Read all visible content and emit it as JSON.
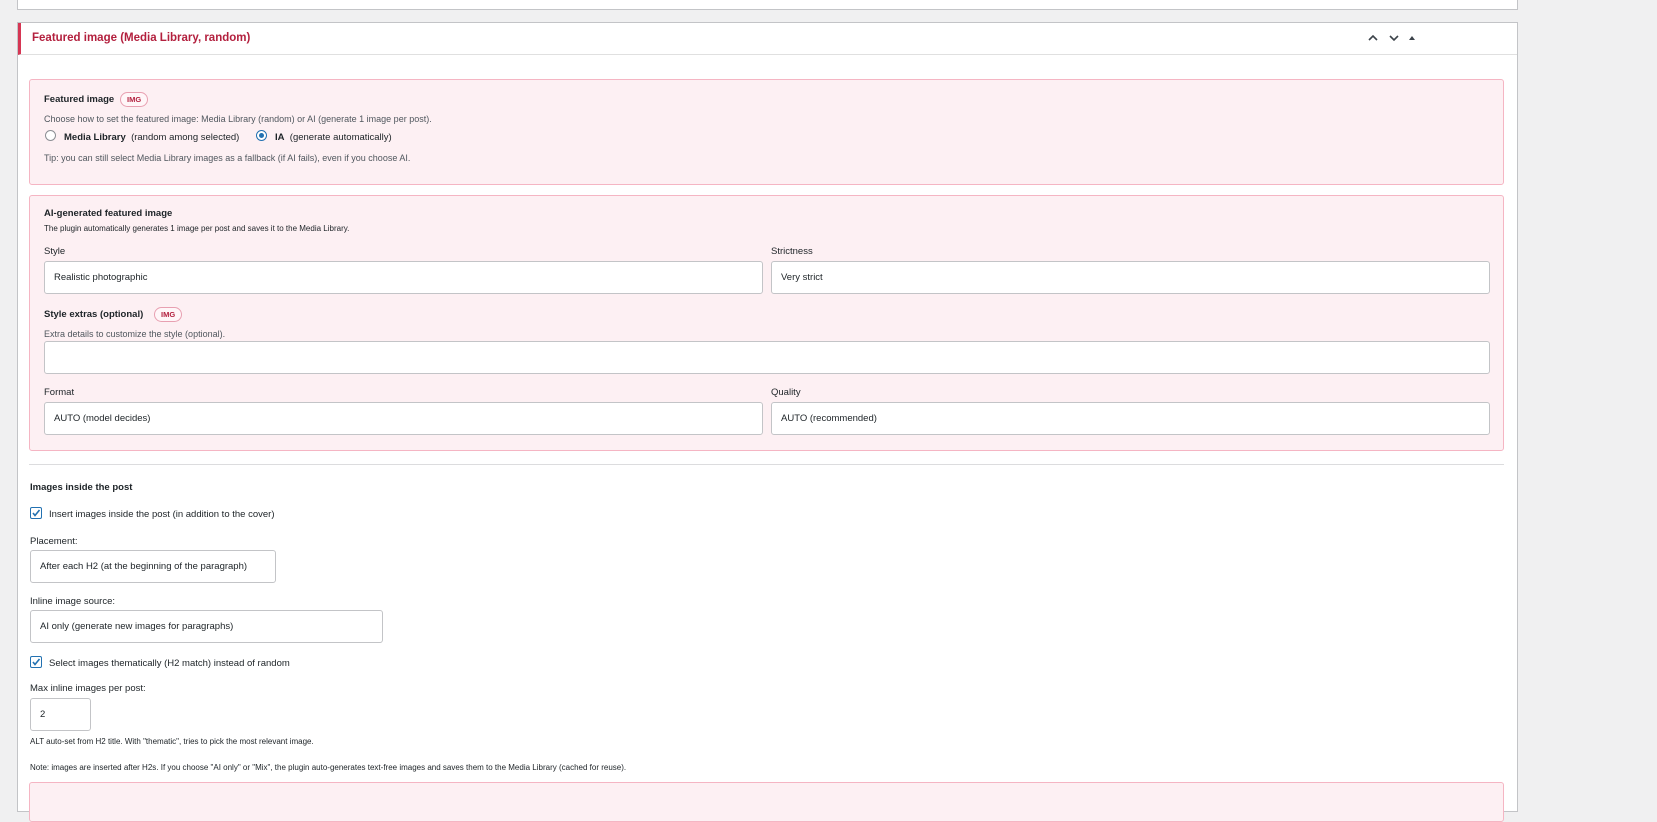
{
  "panel": {
    "title": "Featured image (Media Library, random)"
  },
  "featured": {
    "heading": "Featured image",
    "badge": "IMG",
    "description": "Choose how to set the featured image: Media Library (random) or AI (generate 1 image per post).",
    "options": [
      {
        "label": "Media Library",
        "sub": "(random among selected)",
        "selected": false
      },
      {
        "label": "IA",
        "sub": "(generate automatically)",
        "selected": true
      }
    ],
    "tip": "Tip: you can still select Media Library images as a fallback (if AI fails), even if you choose AI."
  },
  "ai": {
    "heading": "AI-generated featured image",
    "description": "The plugin automatically generates 1 image per post and saves it to the Media Library.",
    "style_label": "Style",
    "style_value": "Realistic photographic",
    "strictness_label": "Strictness",
    "strictness_value": "Very strict",
    "extras_label": "Style extras (optional)",
    "extras_badge": "IMG",
    "extras_help": "Extra details to customize the style (optional).",
    "extras_value": "",
    "format_label": "Format",
    "format_value": "AUTO (model decides)",
    "quality_label": "Quality",
    "quality_value": "AUTO (recommended)"
  },
  "inline": {
    "heading": "Images inside the post",
    "insert_label": "Insert images inside the post (in addition to the cover)",
    "insert_checked": true,
    "placement_label": "Placement:",
    "placement_value": "After each H2 (at the beginning of the paragraph)",
    "source_label": "Inline image source:",
    "source_value": "AI only (generate new images for paragraphs)",
    "thematic_label": "Select images thematically (H2 match) instead of random",
    "thematic_checked": true,
    "max_label": "Max inline images per post:",
    "max_value": "2",
    "alt_note": "ALT auto-set from H2 title. With \"thematic\", tries to pick the most relevant image.",
    "note": "Note: images are inserted after H2s. If you choose \"AI only\" or \"Mix\", the plugin auto-generates text-free images and saves them to the Media Library (cached for reuse)."
  },
  "icons": {
    "move_up": "chevron-up-icon",
    "move_down": "chevron-down-icon",
    "toggle": "caret-up-icon"
  },
  "colors": {
    "accent": "#d63654",
    "title": "#b3203e",
    "box_bg": "#fdf0f3",
    "box_border": "#f5b5c3",
    "check": "#2271b1"
  }
}
